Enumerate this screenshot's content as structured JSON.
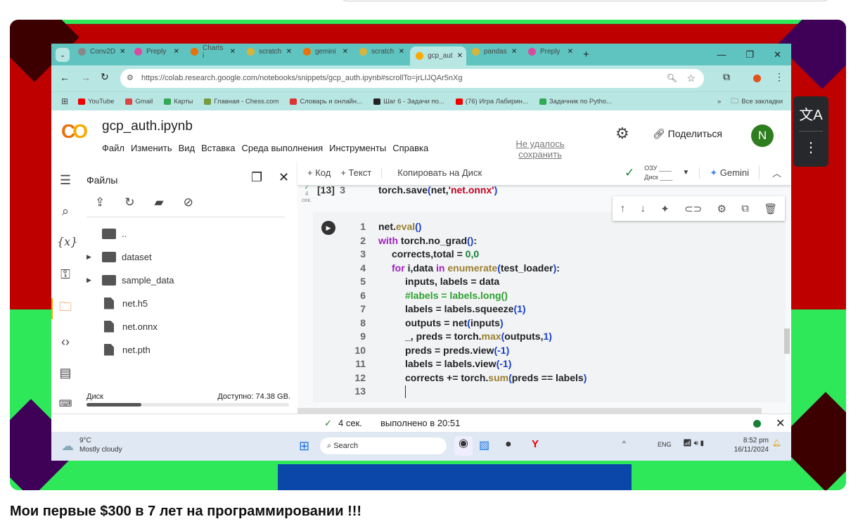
{
  "video_title": "Мои первые $300 в 7 лет на программировании !!!",
  "browser": {
    "tabs": [
      {
        "label": "Conv2D",
        "color": "#888"
      },
      {
        "label": "Preply",
        "color": "#d94aa0"
      },
      {
        "label": "Charts i",
        "color": "#e8710a"
      },
      {
        "label": "scratch",
        "color": "#d9b33a"
      },
      {
        "label": "gemini",
        "color": "#e8710a"
      },
      {
        "label": "scratch",
        "color": "#d9b33a"
      },
      {
        "label": "gcp_aut",
        "color": "#f9ab00",
        "active": true
      },
      {
        "label": "pandas",
        "color": "#d9b33a"
      },
      {
        "label": "Preply",
        "color": "#d94aa0"
      }
    ],
    "url": "https://colab.research.google.com/notebooks/snippets/gcp_auth.ipynb#scrollTo=jrLIJQAr5nXg",
    "bookmarks": [
      {
        "label": "YouTube",
        "color": "#e00"
      },
      {
        "label": "Gmail",
        "color": "#d44"
      },
      {
        "label": "Карты",
        "color": "#34a853"
      },
      {
        "label": "Главная - Chess.com",
        "color": "#7a9a40"
      },
      {
        "label": "Словарь и онлайн...",
        "color": "#d33"
      },
      {
        "label": "Шаг 6 - Задачи по...",
        "color": "#222"
      },
      {
        "label": "(76) Игра Лабирин...",
        "color": "#e00"
      },
      {
        "label": "Задачник по Pytho...",
        "color": "#34a853"
      }
    ],
    "more": "»",
    "all_bookmarks": "Все закладки"
  },
  "colab": {
    "logo": "CO",
    "notebook_title": "gcp_auth.ipynb",
    "menu": [
      "Файл",
      "Изменить",
      "Вид",
      "Вставка",
      "Среда выполнения",
      "Инструменты",
      "Справка"
    ],
    "save_status": "Не удалось сохранить",
    "share": "Поделиться",
    "avatar": "N",
    "toolbar": {
      "add_code": "+ Код",
      "add_text": "+ Текст",
      "copy_drive": "Копировать на Диск",
      "ram": "ОЗУ",
      "disk": "Диск",
      "gemini": "Gemini"
    },
    "files": {
      "title": "Файлы",
      "items": [
        {
          "name": "..",
          "type": "parent"
        },
        {
          "name": "dataset",
          "type": "folder"
        },
        {
          "name": "sample_data",
          "type": "folder"
        },
        {
          "name": "net.h5",
          "type": "file"
        },
        {
          "name": "net.onnx",
          "type": "file"
        },
        {
          "name": "net.pth",
          "type": "file"
        }
      ],
      "disk_label": "Диск",
      "disk_free": "Доступно: 74.38 GB.",
      "disk_used_fraction": 0.27
    },
    "prev_cell": {
      "exec": "[13]",
      "time_a": "4",
      "time_b": "сек.",
      "line_no": "3",
      "tokens": [
        [
          "torch.save",
          ""
        ],
        [
          "(",
          "pa"
        ],
        [
          "net,",
          ""
        ],
        [
          "'net.onnx'",
          "st"
        ],
        [
          ")",
          "pa"
        ]
      ]
    },
    "cell_lines": [
      {
        "n": "1",
        "indent": 0,
        "tokens": [
          [
            "net.",
            ""
          ],
          [
            "eval",
            "fn"
          ],
          [
            "()",
            "pa"
          ]
        ]
      },
      {
        "n": "2",
        "indent": 0,
        "tokens": [
          [
            "with ",
            "kw"
          ],
          [
            "torch.no_grad",
            ""
          ],
          [
            "()",
            "pa"
          ],
          [
            ":",
            ""
          ]
        ]
      },
      {
        "n": "3",
        "indent": 1,
        "tokens": [
          [
            "corrects,total = ",
            ""
          ],
          [
            "0,0",
            "nm"
          ]
        ]
      },
      {
        "n": "4",
        "indent": 1,
        "tokens": [
          [
            "for ",
            "kw"
          ],
          [
            "i,data ",
            ""
          ],
          [
            "in ",
            "kw"
          ],
          [
            "enumerate",
            "fn"
          ],
          [
            "(",
            "pa"
          ],
          [
            "test_loader",
            ""
          ],
          [
            ")",
            "pa"
          ],
          [
            ":",
            ""
          ]
        ]
      },
      {
        "n": "5",
        "indent": 2,
        "tokens": [
          [
            "inputs, labels = data",
            ""
          ]
        ]
      },
      {
        "n": "6",
        "indent": 2,
        "tokens": [
          [
            "#labels = labels.long()",
            "cm"
          ]
        ]
      },
      {
        "n": "7",
        "indent": 2,
        "tokens": [
          [
            "labels = labels.squeeze",
            ""
          ],
          [
            "(1)",
            "pa"
          ]
        ]
      },
      {
        "n": "8",
        "indent": 2,
        "tokens": [
          [
            "outputs = net",
            ""
          ],
          [
            "(",
            "pa"
          ],
          [
            "inputs",
            ""
          ],
          [
            ")",
            "pa"
          ]
        ]
      },
      {
        "n": "9",
        "indent": 2,
        "tokens": [
          [
            "_, preds = torch.",
            ""
          ],
          [
            "max",
            "fn"
          ],
          [
            "(",
            "pa"
          ],
          [
            "outputs,",
            ""
          ],
          [
            "1)",
            "pa"
          ]
        ]
      },
      {
        "n": "10",
        "indent": 2,
        "tokens": [
          [
            "preds = preds.view",
            ""
          ],
          [
            "(-1)",
            "pa"
          ]
        ]
      },
      {
        "n": "11",
        "indent": 2,
        "tokens": [
          [
            "labels = labels.view",
            ""
          ],
          [
            "(-1)",
            "pa"
          ]
        ]
      },
      {
        "n": "12",
        "indent": 2,
        "tokens": [
          [
            "corrects += torch.",
            ""
          ],
          [
            "sum",
            "fn"
          ],
          [
            "(",
            "pa"
          ],
          [
            "preds == labels",
            ""
          ],
          [
            ")",
            "pa"
          ]
        ]
      },
      {
        "n": "13",
        "indent": 2,
        "tokens": []
      }
    ],
    "status": {
      "check": "✓",
      "duration": "4 сек.",
      "completed": "выполнено в 20:51"
    }
  },
  "taskbar": {
    "temp": "9°C",
    "weather": "Mostly cloudy",
    "search": "Search",
    "lang": "ENG",
    "time": "8:52 pm",
    "date": "16/11/2024"
  }
}
